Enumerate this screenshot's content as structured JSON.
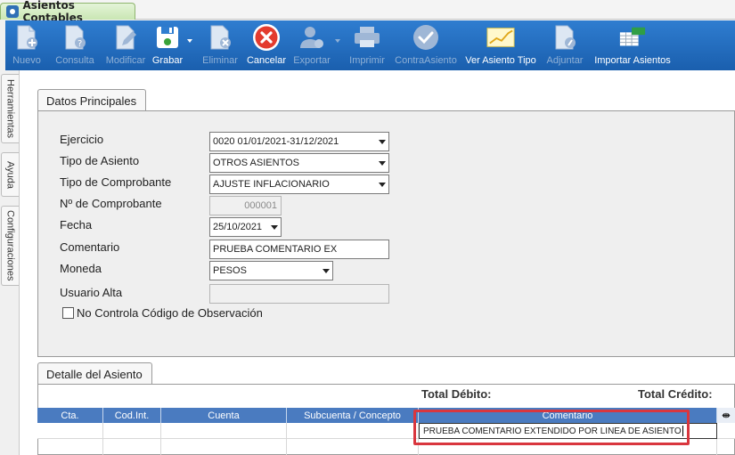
{
  "app_tab": {
    "title": "Asientos Contables"
  },
  "toolbar": {
    "buttons": [
      {
        "id": "nuevo",
        "label": "Nuevo",
        "icon": "new-document-icon",
        "enabled": false
      },
      {
        "id": "consulta",
        "label": "Consulta",
        "icon": "query-document-icon",
        "enabled": false
      },
      {
        "id": "modificar",
        "label": "Modificar",
        "icon": "edit-document-icon",
        "enabled": false
      },
      {
        "id": "grabar",
        "label": "Grabar",
        "icon": "save-icon",
        "enabled": true,
        "has_dropdown": true
      },
      {
        "id": "eliminar",
        "label": "Eliminar",
        "icon": "delete-document-icon",
        "enabled": false
      },
      {
        "id": "cancelar",
        "label": "Cancelar",
        "icon": "cancel-icon",
        "enabled": true
      },
      {
        "id": "exportar",
        "label": "Exportar",
        "icon": "export-user-icon",
        "enabled": false,
        "has_dropdown": true
      },
      {
        "id": "imprimir",
        "label": "Imprimir",
        "icon": "printer-icon",
        "enabled": false
      },
      {
        "id": "contraasiento",
        "label": "ContraAsiento",
        "icon": "check-circle-icon",
        "enabled": false
      },
      {
        "id": "ver_asiento_tipo",
        "label": "Ver Asiento Tipo",
        "icon": "chart-icon",
        "enabled": true
      },
      {
        "id": "adjuntar",
        "label": "Adjuntar",
        "icon": "attach-document-icon",
        "enabled": false
      },
      {
        "id": "importar_asientos",
        "label": "Importar Asientos",
        "icon": "excel-import-icon",
        "enabled": true
      }
    ]
  },
  "side_tabs": [
    "Herramientas",
    "Ayuda",
    "Configuraciones"
  ],
  "datos_principales": {
    "title": "Datos Principales",
    "ejercicio": {
      "label": "Ejercicio",
      "value": "0020 01/01/2021-31/12/2021"
    },
    "tipo_asiento": {
      "label": "Tipo de Asiento",
      "value": "OTROS ASIENTOS"
    },
    "tipo_comprobante": {
      "label": "Tipo de Comprobante",
      "value": "AJUSTE INFLACIONARIO"
    },
    "nro_comprobante": {
      "label": "Nº de Comprobante",
      "value": "000001"
    },
    "fecha": {
      "label": "Fecha",
      "value": "25/10/2021"
    },
    "comentario": {
      "label": "Comentario",
      "value": "PRUEBA COMENTARIO EX"
    },
    "moneda": {
      "label": "Moneda",
      "value": "PESOS"
    },
    "usuario_alta": {
      "label": "Usuario Alta",
      "value": ""
    },
    "no_controla": {
      "label": "No Controla Código de Observación",
      "checked": false
    }
  },
  "detalle": {
    "title": "Detalle del Asiento",
    "total_debito_label": "Total Débito:",
    "total_credito_label": "Total Crédito:",
    "columns": [
      "Cta.",
      "Cod.Int.",
      "Cuenta",
      "Subcuenta / Concepto",
      "Comentario"
    ],
    "rows": [
      {
        "cta": "",
        "cod_int": "",
        "cuenta": "",
        "subcuenta": "",
        "comentario": "PRUEBA COMENTARIO EXTENDIDO POR LINEA DE ASIENTO"
      }
    ]
  },
  "colors": {
    "toolbar_bg": "#1f67b8",
    "grid_header": "#4a7bc0",
    "highlight": "#d9363e",
    "tab_green": "#c9e6b3"
  }
}
